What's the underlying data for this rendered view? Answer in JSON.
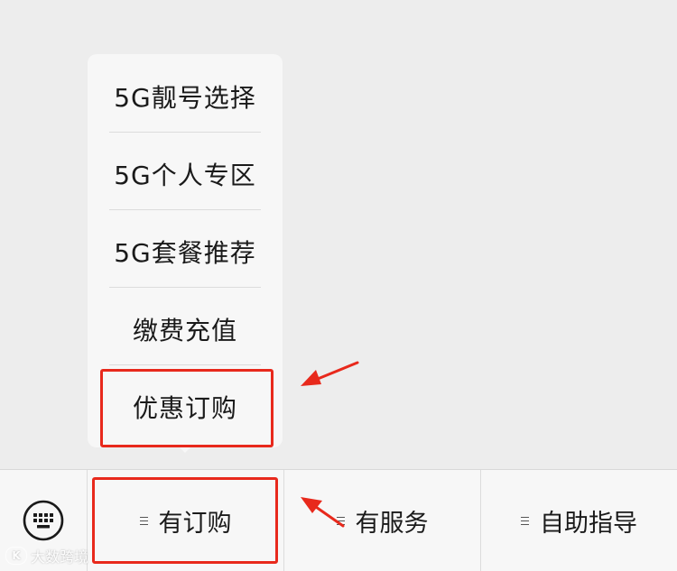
{
  "popup_menu": {
    "items": [
      {
        "label": "5G靓号选择"
      },
      {
        "label": "5G个人专区"
      },
      {
        "label": "5G套餐推荐"
      },
      {
        "label": "缴费充值"
      },
      {
        "label": "优惠订购"
      }
    ]
  },
  "bottom_bar": {
    "keyboard_icon": "keyboard-icon",
    "tabs": [
      {
        "label": "有订购",
        "icon": "menu-lines-icon"
      },
      {
        "label": "有服务",
        "icon": "menu-lines-icon"
      },
      {
        "label": "自助指导",
        "icon": "menu-lines-icon"
      }
    ]
  },
  "annotations": {
    "highlight_color": "#e8291c",
    "arrow_color": "#e8291c"
  },
  "watermark": {
    "text": "大数跨境",
    "logo": "K"
  },
  "colors": {
    "background": "#ededed",
    "panel": "#f7f7f7",
    "text": "#1a1a1a",
    "divider": "#dcdcdc"
  }
}
